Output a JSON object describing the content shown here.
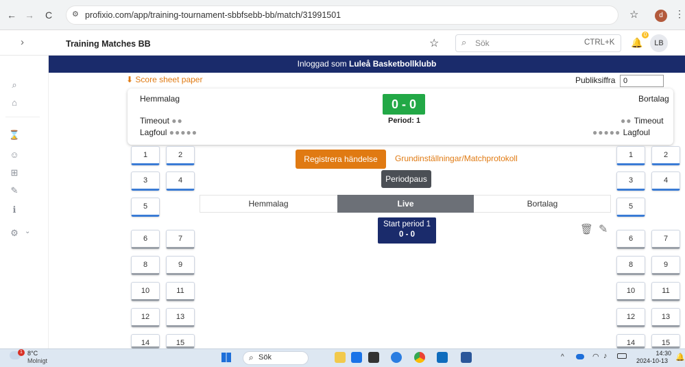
{
  "browser": {
    "url": "profixio.com/app/training-tournament-sbbfsebb-bb/match/31991501",
    "avatar_letter": "d"
  },
  "appbar": {
    "title": "Training Matches BB",
    "search_placeholder": "Sök",
    "shortcut": "CTRL+K",
    "notification_count": "0",
    "user_initials": "LB"
  },
  "banner": {
    "prefix": "Inloggad som ",
    "club": "Luleå Basketbollklubb"
  },
  "score_sheet": "Score sheet paper",
  "attendance": {
    "label": "Publiksiffra",
    "value": "0"
  },
  "match": {
    "home": "Hemmalag",
    "away": "Bortalag",
    "score": "0 - 0",
    "period": "Period: 1",
    "timeout_label": "Timeout",
    "teamfoul_label": "Lagfoul",
    "timeout_dots": "●●",
    "teamfoul_dots": "●●●●●"
  },
  "actions": {
    "register": "Registrera händelse",
    "settings": "Grundinställningar/Matchprotokoll",
    "period_pause": "Periodpaus"
  },
  "tabs": [
    "Hemmalag",
    "Live",
    "Bortalag"
  ],
  "live_event": {
    "title": "Start period 1",
    "score": "0 - 0"
  },
  "players": [
    "1",
    "2",
    "3",
    "4",
    "5",
    "6",
    "7",
    "8",
    "9",
    "10",
    "11",
    "12",
    "13",
    "14",
    "15"
  ],
  "taskbar": {
    "temperature": "8°C",
    "weather": "Molnigt",
    "search": "Sök",
    "time": "14:30",
    "date": "2024-10-13",
    "weather_badge": "1"
  }
}
